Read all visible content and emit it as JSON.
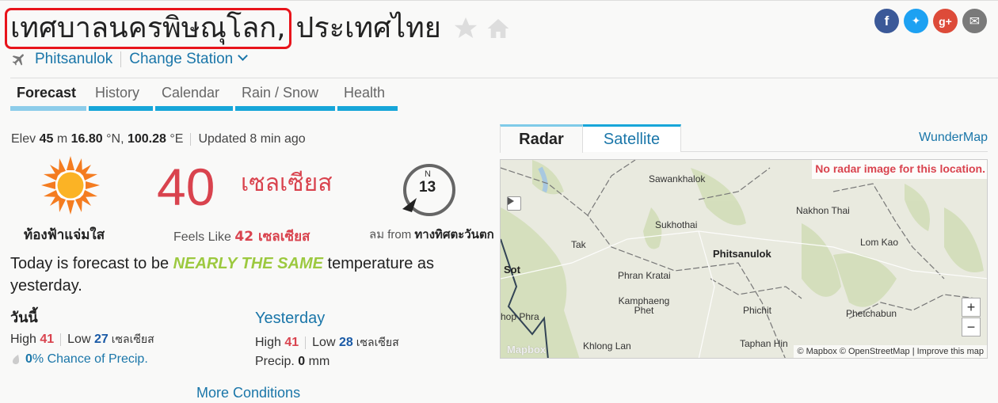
{
  "header": {
    "city": "เทศบาลนครพิษณุโลก,",
    "country": "ประเทศไทย",
    "social": [
      {
        "name": "facebook",
        "glyph": "f",
        "color": "#3b5998"
      },
      {
        "name": "twitter",
        "glyph": "🐦",
        "color": "#1da1f2"
      },
      {
        "name": "google-plus",
        "glyph": "g+",
        "color": "#dd4b39"
      },
      {
        "name": "email",
        "glyph": "✉",
        "color": "#7a7a7a"
      }
    ]
  },
  "station": {
    "name": "Phitsanulok",
    "change_label": "Change Station"
  },
  "tabs": [
    {
      "label": "Forecast",
      "active": true
    },
    {
      "label": "History",
      "active": false
    },
    {
      "label": "Calendar",
      "active": false
    },
    {
      "label": "Rain / Snow",
      "active": false
    },
    {
      "label": "Health",
      "active": false
    }
  ],
  "meta": {
    "elev_label": "Elev",
    "elev_value": "45",
    "elev_unit": "m",
    "lat": "16.80",
    "lat_unit": "°N,",
    "lon": "100.28",
    "lon_unit": "°E",
    "updated": "Updated 8 min ago"
  },
  "current": {
    "condition": "ท้องฟ้าแจ่มใส",
    "temp": "40",
    "temp_unit": "เซลเซียส",
    "feels_label": "Feels Like",
    "feels_value": "42 เซลเซียส",
    "wind_dir_label": "N",
    "wind_speed": "13",
    "wind_from_label": "ลม from",
    "wind_from_value": "ทางทิศตะวันตก"
  },
  "summary": {
    "prefix": "Today is forecast to be",
    "highlight": "NEARLY THE SAME",
    "suffix": "temperature as yesterday."
  },
  "today": {
    "title": "วันนี้",
    "high_label": "High",
    "high": "41",
    "low_label": "Low",
    "low": "27",
    "unit": "เซลเซียส",
    "precip_value": "0",
    "precip_label": "% Chance of Precip."
  },
  "yesterday": {
    "title": "Yesterday",
    "high_label": "High",
    "high": "41",
    "low_label": "Low",
    "low": "28",
    "unit": "เซลเซียส",
    "precip_label": "Precip.",
    "precip_value": "0",
    "precip_unit": "mm"
  },
  "more_conditions": "More Conditions",
  "map": {
    "tabs": [
      "Radar",
      "Satellite"
    ],
    "wundermap_label": "WunderMap",
    "no_radar": "No radar image for this location.",
    "labels": [
      "Sawankhalok",
      "Nakhon Thai",
      "Sukhothai",
      "Tak",
      "Phitsanulok",
      "Lom Kao",
      "Sot",
      "Phran Kratai",
      "Kamphaeng Phet",
      "Phichit",
      "hop Phra",
      "Phetchabun",
      "Khlong Lan",
      "Taphan Hin"
    ],
    "zoom_in": "+",
    "zoom_out": "−",
    "attribution": "© Mapbox © OpenStreetMap | Improve this map",
    "logo": "Mapbox"
  }
}
